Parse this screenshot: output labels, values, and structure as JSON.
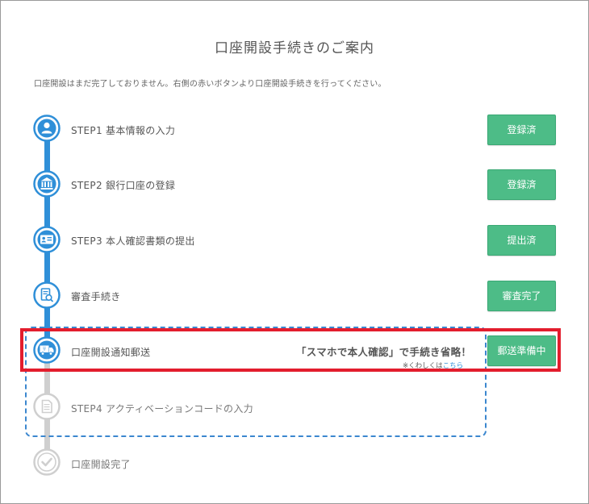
{
  "title": "口座開設手続きのご案内",
  "intro": "口座開設はまだ完了しておりません。右側の赤いボタンより口座開設手続きを行ってください。",
  "steps": [
    {
      "label": "STEP1 基本情報の入力",
      "status": "登録済",
      "icon": "person-icon"
    },
    {
      "label": "STEP2 銀行口座の登録",
      "status": "登録済",
      "icon": "bank-icon"
    },
    {
      "label": "STEP3 本人確認書類の提出",
      "status": "提出済",
      "icon": "id-card-icon"
    },
    {
      "label": "審査手続き",
      "status": "審査完了",
      "icon": "document-search-icon"
    },
    {
      "label": "口座開設通知郵送",
      "status": "郵送準備中",
      "icon": "truck-icon"
    },
    {
      "label": "STEP4 アクティベーションコードの入力",
      "icon": "document-icon"
    },
    {
      "label": "口座開設完了",
      "icon": "check-icon"
    }
  ],
  "promo": {
    "text": "「スマホで本人確認」で手続き省略！",
    "note_prefix": "※くわしくは",
    "note_link": "こちら"
  },
  "colors": {
    "active": "#2f8fd8",
    "inactive": "#cfcfcf",
    "button": "#4dbc87",
    "highlight": "#e31d2d"
  }
}
